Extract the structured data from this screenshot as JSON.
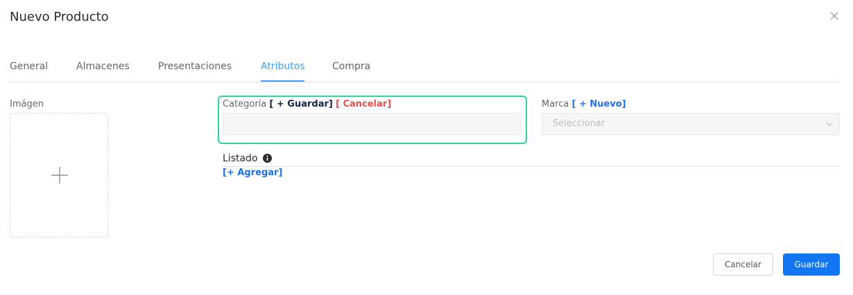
{
  "dialog": {
    "title": "Nuevo Producto",
    "close_icon": "close-icon"
  },
  "tabs": [
    {
      "label": "General"
    },
    {
      "label": "Almacenes"
    },
    {
      "label": "Presentaciones"
    },
    {
      "label": "Atributos",
      "active": true
    },
    {
      "label": "Compra"
    }
  ],
  "image": {
    "label": "Imágen",
    "icon": "plus-icon"
  },
  "categoria": {
    "label": "Categoría",
    "save_link": "[ + Guardar]",
    "cancel_link": "[ Cancelar]",
    "value": ""
  },
  "marca": {
    "label": "Marca",
    "new_link": "[ + Nuevo]",
    "placeholder": "Seleccionar"
  },
  "listado": {
    "label": "Listado",
    "add_link": "[+ Agregar]"
  },
  "footer": {
    "cancel_label": "Cancelar",
    "save_label": "Guardar"
  },
  "colors": {
    "accent": "#409eff",
    "primary_button": "#1275f2",
    "highlight_border": "#2ed39a",
    "danger": "#f04b4b",
    "dark_link": "#13234f"
  }
}
